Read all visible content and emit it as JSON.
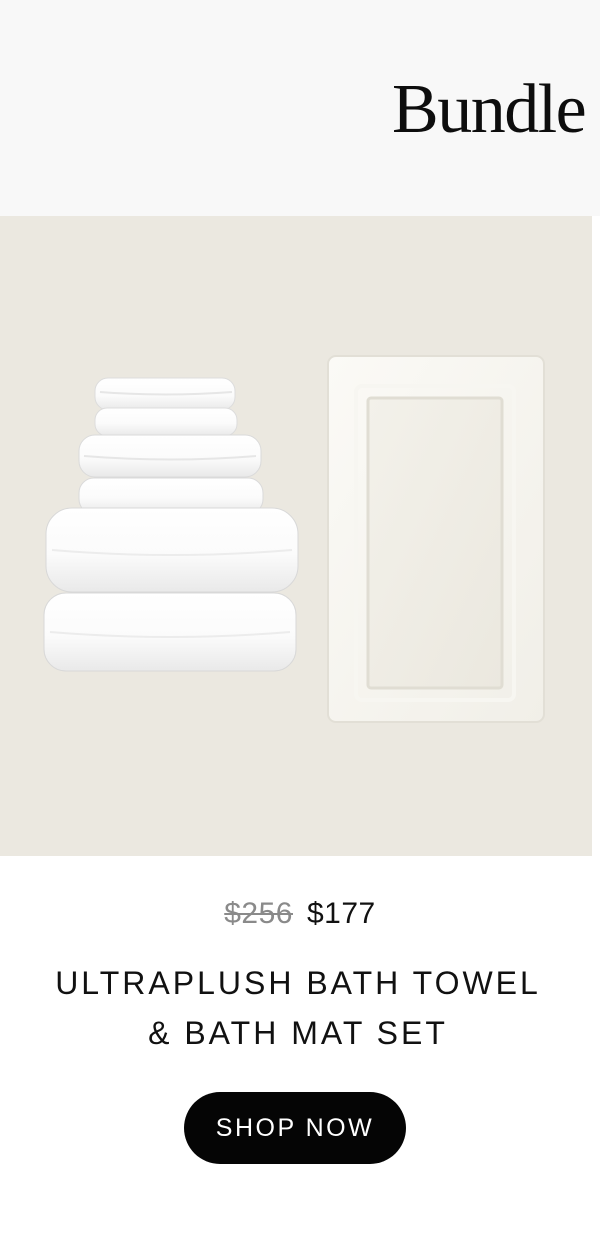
{
  "header": {
    "title": "Bundle"
  },
  "hero": {
    "image_name": "towel-and-bath-mat-product-image"
  },
  "product": {
    "price_original": "$256",
    "price_sale": "$177",
    "title_line_1": "ULTRAPLUSH BATH TOWEL",
    "title_line_2": "& BATH MAT SET"
  },
  "cta": {
    "label": "SHOP NOW"
  },
  "colors": {
    "header_bg": "#f8f8f8",
    "hero_bg": "#ebe8e0",
    "button_bg": "#050505",
    "button_text": "#ffffff",
    "strike_price": "#8a8a8a"
  }
}
